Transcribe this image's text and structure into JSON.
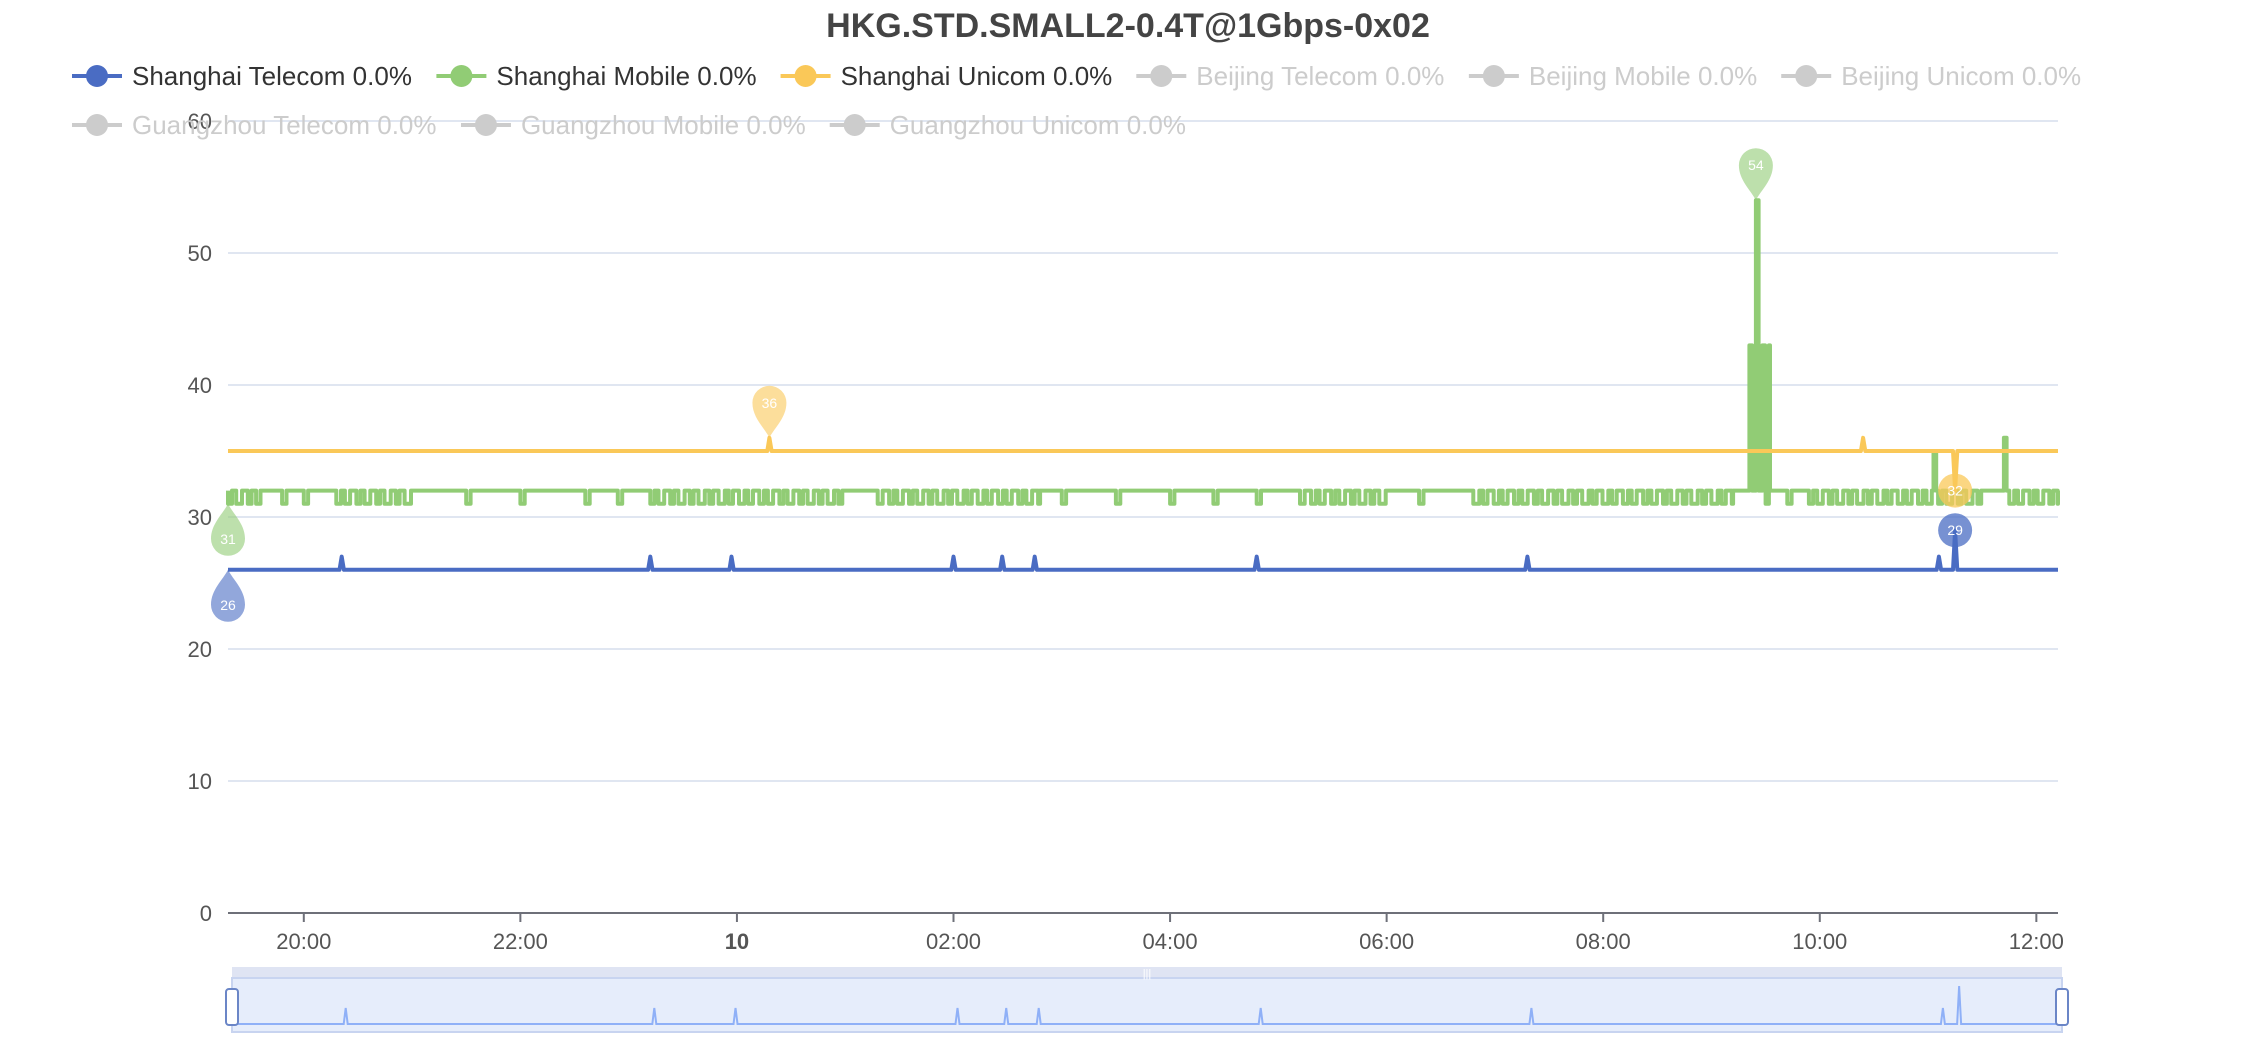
{
  "chart_data": {
    "type": "line",
    "title": "HKG.STD.SMALL2-0.4T@1Gbps-0x02",
    "xlabel": "",
    "ylabel": "",
    "ylim": [
      0,
      60
    ],
    "y_ticks": [
      0,
      10,
      20,
      30,
      40,
      50,
      60
    ],
    "grid": true,
    "legend_position": "top",
    "x_domain_hours": [
      19.3,
      36.2
    ],
    "x_ticks": [
      {
        "label": "20:00",
        "hour": 20,
        "bold": false
      },
      {
        "label": "22:00",
        "hour": 22,
        "bold": false
      },
      {
        "label": "10",
        "hour": 24,
        "bold": true
      },
      {
        "label": "02:00",
        "hour": 26,
        "bold": false
      },
      {
        "label": "04:00",
        "hour": 28,
        "bold": false
      },
      {
        "label": "06:00",
        "hour": 30,
        "bold": false
      },
      {
        "label": "08:00",
        "hour": 32,
        "bold": false
      },
      {
        "label": "10:00",
        "hour": 34,
        "bold": false
      },
      {
        "label": "12:00",
        "hour": 36,
        "bold": false
      }
    ],
    "series": [
      {
        "name": "Shanghai Telecom 0.0%",
        "color": "#4a6cc3",
        "active": true,
        "baseline": 26,
        "spikes": [
          [
            20.35,
            27
          ],
          [
            23.2,
            27
          ],
          [
            23.95,
            27
          ],
          [
            26.0,
            27
          ],
          [
            26.45,
            27
          ],
          [
            26.75,
            27
          ],
          [
            28.8,
            27
          ],
          [
            31.3,
            27
          ],
          [
            35.1,
            27
          ],
          [
            35.25,
            29
          ]
        ],
        "markers": [
          {
            "hour": 19.3,
            "value": 26,
            "label": "26"
          },
          {
            "hour": 35.25,
            "value": 29,
            "label": "29"
          }
        ]
      },
      {
        "name": "Shanghai Mobile 0.0%",
        "color": "#91cc75",
        "active": true,
        "baseline": 32,
        "alt_value": 31,
        "dense_segments": [
          [
            19.3,
            19.6
          ],
          [
            20.3,
            21.0
          ],
          [
            23.2,
            25.0
          ],
          [
            25.3,
            26.8
          ],
          [
            29.2,
            30.0
          ],
          [
            30.8,
            33.2
          ],
          [
            33.9,
            35.5
          ],
          [
            35.75,
            36.2
          ]
        ],
        "sparse_points": [
          19.8,
          20.0,
          21.5,
          22.0,
          22.6,
          22.9,
          27.0,
          27.5,
          28.0,
          28.4,
          28.8,
          30.3,
          33.5,
          33.7
        ],
        "spikes": [
          [
            33.35,
            43
          ],
          [
            33.41,
            54
          ],
          [
            33.47,
            43
          ],
          [
            33.53,
            43
          ],
          [
            35.05,
            35
          ],
          [
            35.7,
            36
          ]
        ],
        "markers": [
          {
            "hour": 19.3,
            "value": 31,
            "label": "31"
          },
          {
            "hour": 33.41,
            "value": 54,
            "label": "54"
          }
        ]
      },
      {
        "name": "Shanghai Unicom 0.0%",
        "color": "#fac858",
        "active": true,
        "baseline": 35,
        "spikes": [
          [
            24.3,
            36
          ],
          [
            34.4,
            36
          ],
          [
            35.2,
            35
          ],
          [
            35.25,
            32
          ]
        ],
        "markers": [
          {
            "hour": 24.3,
            "value": 36,
            "label": "36"
          },
          {
            "hour": 35.25,
            "value": 32,
            "label": "32"
          }
        ]
      },
      {
        "name": "Beijing Telecom 0.0%",
        "color": "#cccccc",
        "active": false
      },
      {
        "name": "Beijing Mobile 0.0%",
        "color": "#cccccc",
        "active": false
      },
      {
        "name": "Beijing Unicom 0.0%",
        "color": "#cccccc",
        "active": false
      },
      {
        "name": "Guangzhou Telecom 0.0%",
        "color": "#cccccc",
        "active": false
      },
      {
        "name": "Guangzhou Mobile 0.0%",
        "color": "#cccccc",
        "active": false
      },
      {
        "name": "Guangzhou Unicom 0.0%",
        "color": "#cccccc",
        "active": false
      }
    ],
    "data_zoom": {
      "range_percent": [
        0,
        100
      ],
      "handle_label": "|||"
    }
  }
}
